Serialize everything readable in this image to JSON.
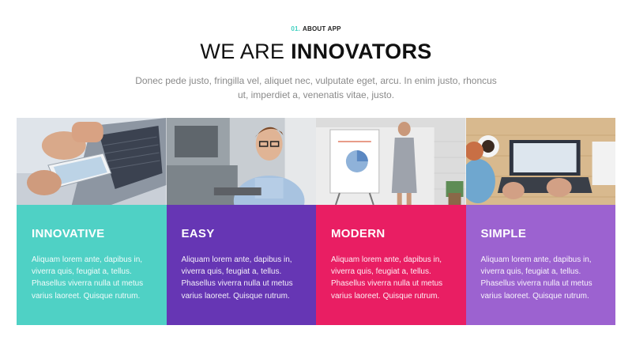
{
  "section": {
    "number": "01.",
    "label": "ABOUT APP",
    "heading_light": "WE ARE",
    "heading_strong": "INNOVATORS",
    "intro": "Donec pede justo, fringilla vel, aliquet nec, vulputate eget, arcu. In enim justo, rhoncus ut, imperdiet a, venenatis vitae, justo."
  },
  "cards": [
    {
      "title": "INNOVATIVE",
      "text": "Aliquam lorem ante, dapibus in, viverra quis, feugiat a, tellus. Phasellus viverra nulla ut metus varius laoreet. Quisque rutrum.",
      "color": "#4fd1c5",
      "photo": "tablet-and-laptop-photo"
    },
    {
      "title": "EASY",
      "text": "Aliquam lorem ante, dapibus in, viverra quis, feugiat a, tellus. Phasellus viverra nulla ut metus varius laoreet. Quisque rutrum.",
      "color": "#6636b4",
      "photo": "man-at-desk-photo"
    },
    {
      "title": "MODERN",
      "text": "Aliquam lorem ante, dapibus in, viverra quis, feugiat a, tellus. Phasellus viverra nulla ut metus varius laoreet. Quisque rutrum.",
      "color": "#e91e63",
      "photo": "presentation-photo"
    },
    {
      "title": "SIMPLE",
      "text": "Aliquam lorem ante, dapibus in, viverra quis, feugiat a, tellus. Phasellus viverra nulla ut metus varius laoreet. Quisque rutrum.",
      "color": "#9c62d0",
      "photo": "laptop-and-coffee-photo"
    }
  ]
}
